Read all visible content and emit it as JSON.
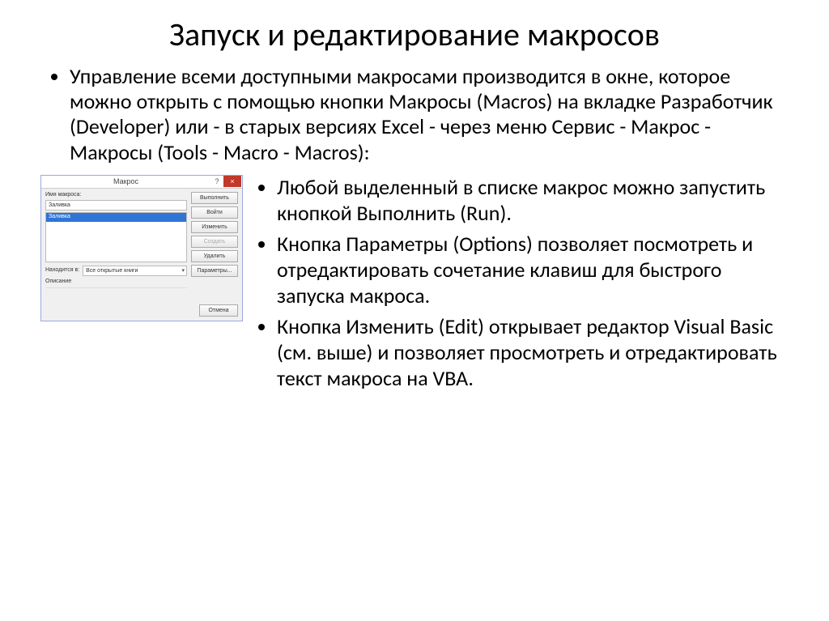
{
  "title": "Запуск и редактирование макросов",
  "top_bullet": "Управление всеми доступными макросами производится в окне, которое можно открыть с помощью кнопки Макросы (Macros) на вкладке Разработчик (Developer) или - в старых версиях Excel - через меню Сервис - Макрос - Макросы (Tools - Macro - Macros):",
  "bullets2": {
    "b1": "Любой выделенный в списке макрос можно запустить кнопкой Выполнить (Run).",
    "b2": "Кнопка Параметры (Options) позволяет посмотреть и отредактировать сочетание клавиш для быстрого запуска макроса.",
    "b3": "Кнопка Изменить (Edit) открывает редактор Visual Basic (см. выше) и позволяет просмотреть и отредактировать текст макроса на VBA."
  },
  "dialog": {
    "title": "Макрос",
    "help": "?",
    "close": "×",
    "label_name": "Имя макроса:",
    "input_name": "Заливка",
    "list_item_selected": "Заливка",
    "btn_run": "Выполнить",
    "btn_stepin": "Войти",
    "btn_edit": "Изменить",
    "btn_create": "Создать",
    "btn_delete": "Удалить",
    "btn_options": "Параметры...",
    "label_in": "Находится в:",
    "select_value": "Все открытые книги",
    "label_desc": "Описание",
    "btn_cancel": "Отмена"
  }
}
